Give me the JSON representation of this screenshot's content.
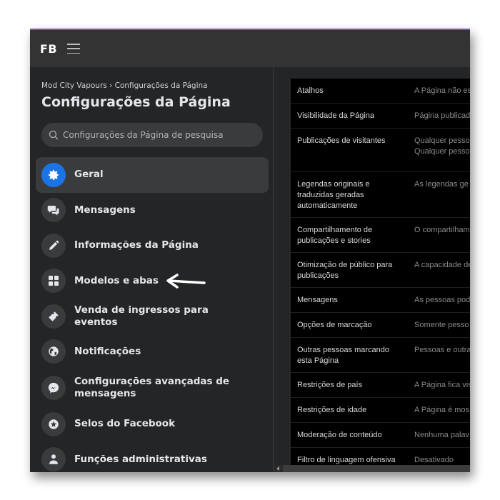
{
  "topbar": {
    "logo": "FB"
  },
  "sidebar": {
    "breadcrumb": "Mod City Vapours › Configurações da Página",
    "title": "Configurações da Página",
    "search_placeholder": "Configurações da Página de pesquisa",
    "items": [
      {
        "label": "Geral",
        "icon": "gear-icon",
        "active": true
      },
      {
        "label": "Mensagens",
        "icon": "chat-bubbles-icon"
      },
      {
        "label": "Informações da Página",
        "icon": "pencil-icon"
      },
      {
        "label": "Modelos e abas",
        "icon": "grid-icon"
      },
      {
        "label": "Venda de ingressos para eventos",
        "icon": "ticket-icon"
      },
      {
        "label": "Notificações",
        "icon": "globe-icon"
      },
      {
        "label": "Configurações avançadas de mensagens",
        "icon": "messenger-icon"
      },
      {
        "label": "Selos do Facebook",
        "icon": "star-badge-icon"
      },
      {
        "label": "Funções administrativas",
        "icon": "person-icon"
      }
    ]
  },
  "settings_table": {
    "rows": [
      {
        "label": "Atalhos",
        "value": "A Página não es"
      },
      {
        "label": "Visibilidade da Página",
        "value": "Página publicad"
      },
      {
        "label": "Publicações de visitantes",
        "value": "Qualquer pesso\nQualquer pesso"
      },
      {
        "label": "Legendas originais e traduzidas geradas automaticamente",
        "value": "As legendas ge"
      },
      {
        "label": "Compartilhamento de publicações e stories",
        "value": "O compartilham"
      },
      {
        "label": "Otimização de público para publicações",
        "value": "A capacidade de"
      },
      {
        "label": "Mensagens",
        "value": "As pessoas pod"
      },
      {
        "label": "Opções de marcação",
        "value": "Somente pesso"
      },
      {
        "label": "Outras pessoas marcando esta Página",
        "value": "Pessoas e outra"
      },
      {
        "label": "Restrições de país",
        "value": "A Página fica vis"
      },
      {
        "label": "Restrições de idade",
        "value": "A Página é mos"
      },
      {
        "label": "Moderação de conteúdo",
        "value": "Nenhuma palav"
      },
      {
        "label": "Filtro de linguagem ofensiva",
        "value": "Desativado"
      }
    ]
  },
  "colors": {
    "accent": "#1b74e4",
    "window_border": "#7b5ea7"
  }
}
